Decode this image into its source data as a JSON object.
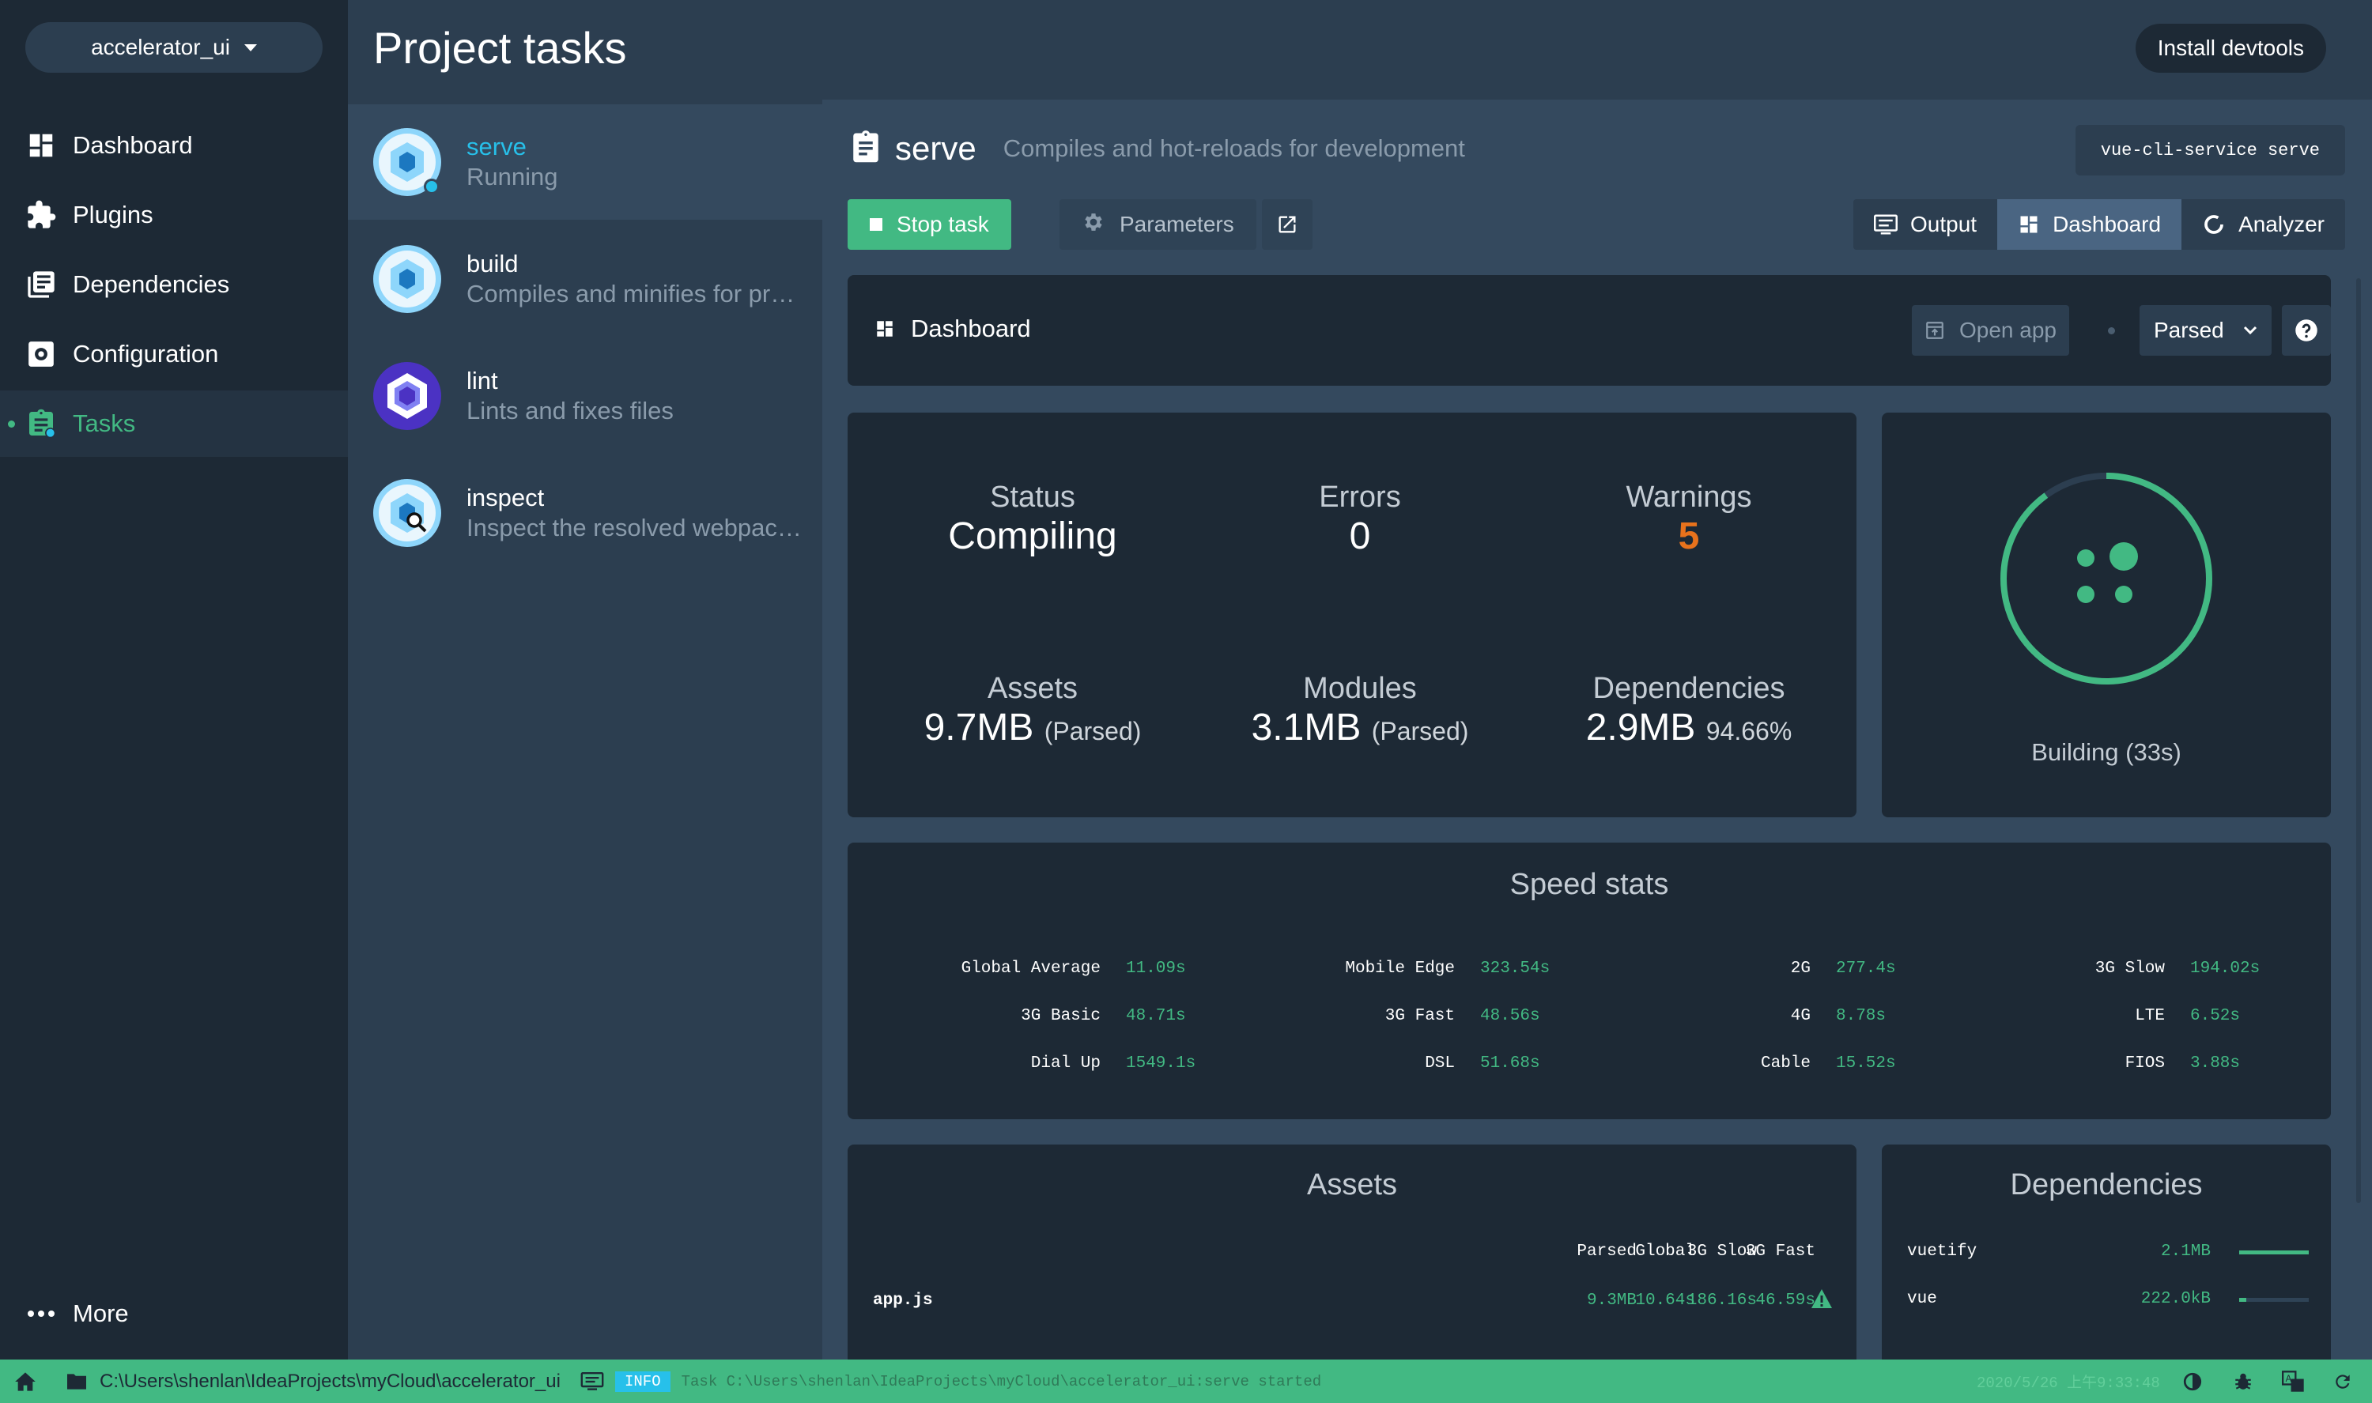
{
  "nav": {
    "project": "accelerator_ui",
    "items": [
      {
        "label": "Dashboard"
      },
      {
        "label": "Plugins"
      },
      {
        "label": "Dependencies"
      },
      {
        "label": "Configuration"
      },
      {
        "label": "Tasks"
      }
    ],
    "more": "More"
  },
  "header": {
    "title": "Project tasks",
    "devtools": "Install devtools"
  },
  "tasklist": {
    "search_placeholder": "",
    "tasks": [
      {
        "name": "serve",
        "desc": "Running"
      },
      {
        "name": "build",
        "desc": "Compiles and minifies for production"
      },
      {
        "name": "lint",
        "desc": "Lints and fixes files"
      },
      {
        "name": "inspect",
        "desc": "Inspect the resolved webpack config"
      }
    ]
  },
  "task": {
    "name": "serve",
    "description": "Compiles and hot-reloads for development",
    "command": "vue-cli-service serve",
    "stop_label": "Stop task",
    "params_label": "Parameters",
    "tabs": [
      {
        "label": "Output"
      },
      {
        "label": "Dashboard"
      },
      {
        "label": "Analyzer"
      }
    ]
  },
  "dashboard": {
    "title": "Dashboard",
    "open_app": "Open app",
    "size_mode": "Parsed",
    "stats": {
      "status": {
        "label": "Status",
        "value": "Compiling"
      },
      "errors": {
        "label": "Errors",
        "value": "0"
      },
      "warnings": {
        "label": "Warnings",
        "value": "5"
      },
      "assets": {
        "label": "Assets",
        "value": "9.7MB",
        "unit": "(Parsed)"
      },
      "modules": {
        "label": "Modules",
        "value": "3.1MB",
        "unit": "(Parsed)"
      },
      "dependencies": {
        "label": "Dependencies",
        "value": "2.9MB",
        "unit": "94.66%"
      }
    },
    "progress": {
      "fraction": 0.9,
      "label": "Building (33s)"
    },
    "speed": {
      "title": "Speed stats",
      "items": [
        {
          "label": "Global Average",
          "value": "11.09s"
        },
        {
          "label": "Mobile Edge",
          "value": "323.54s"
        },
        {
          "label": "2G",
          "value": "277.4s"
        },
        {
          "label": "3G Slow",
          "value": "194.02s"
        },
        {
          "label": "3G Basic",
          "value": "48.71s"
        },
        {
          "label": "3G Fast",
          "value": "48.56s"
        },
        {
          "label": "4G",
          "value": "8.78s"
        },
        {
          "label": "LTE",
          "value": "6.52s"
        },
        {
          "label": "Dial Up",
          "value": "1549.1s"
        },
        {
          "label": "DSL",
          "value": "51.68s"
        },
        {
          "label": "Cable",
          "value": "15.52s"
        },
        {
          "label": "FIOS",
          "value": "3.88s"
        }
      ]
    },
    "assets": {
      "title": "Assets",
      "columns": [
        "Parsed",
        "Global",
        "3G Slow",
        "3G Fast"
      ],
      "rows": [
        {
          "name": "app.js",
          "parsed": "9.3MB",
          "global": "10.64s",
          "slow": "186.16s",
          "fast": "46.59s"
        }
      ]
    },
    "deps": {
      "title": "Dependencies",
      "rows": [
        {
          "name": "vuetify",
          "size": "2.1MB",
          "fraction": 1.0
        },
        {
          "name": "vue",
          "size": "222.0kB",
          "fraction": 0.1
        }
      ]
    }
  },
  "statusbar": {
    "path": "C:\\Users\\shenlan\\IdeaProjects\\myCloud\\accelerator_ui",
    "badge": "INFO",
    "log": "Task C:\\Users\\shenlan\\IdeaProjects\\myCloud\\accelerator_ui:serve started",
    "time": "2020/5/26 上午9:33:48"
  },
  "colors": {
    "accent": "#42b983",
    "info": "#27c0ea",
    "warning": "#e8721c",
    "bg_dark": "#1d2935",
    "bg_mid": "#2c3e50",
    "bg_panel": "#34495e"
  }
}
